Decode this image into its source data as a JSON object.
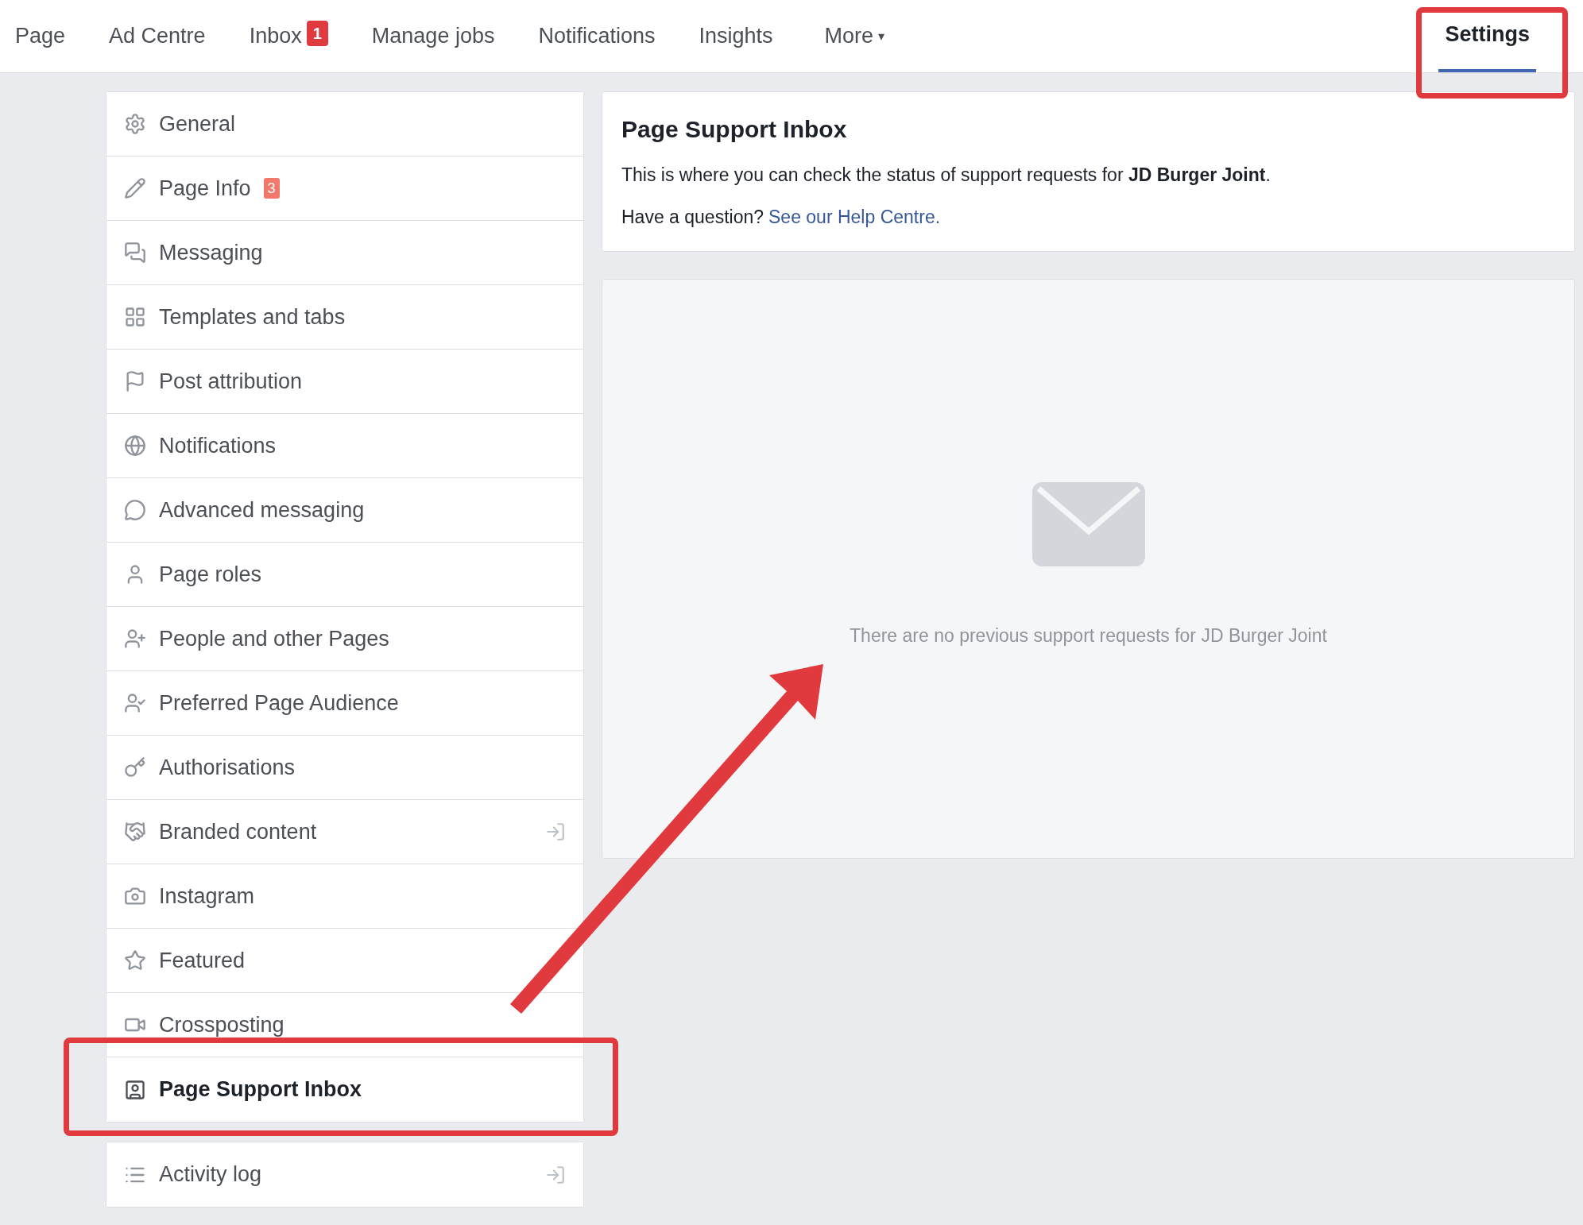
{
  "nav": {
    "tabs": [
      {
        "label": "Page",
        "selected": false
      },
      {
        "label": "Ad Centre",
        "selected": false
      },
      {
        "label": "Inbox",
        "badge": "1",
        "selected": false
      },
      {
        "label": "Manage jobs",
        "selected": false
      },
      {
        "label": "Notifications",
        "selected": false
      },
      {
        "label": "Insights",
        "selected": false
      },
      {
        "label": "More",
        "caret": "▾",
        "selected": false
      }
    ],
    "right_tab": {
      "label": "Settings",
      "selected": true
    }
  },
  "sidebar": {
    "items": [
      {
        "label": "General",
        "selected": false
      },
      {
        "label": "Page Info",
        "badge": "3",
        "selected": false
      },
      {
        "label": "Messaging",
        "selected": false
      },
      {
        "label": "Templates and tabs",
        "selected": false
      },
      {
        "label": "Post attribution",
        "selected": false
      },
      {
        "label": "Notifications",
        "selected": false
      },
      {
        "label": "Advanced messaging",
        "selected": false
      },
      {
        "label": "Page roles",
        "selected": false
      },
      {
        "label": "People and other Pages",
        "selected": false
      },
      {
        "label": "Preferred Page Audience",
        "selected": false
      },
      {
        "label": "Authorisations",
        "selected": false
      },
      {
        "label": "Branded content",
        "external": true,
        "selected": false
      },
      {
        "label": "Instagram",
        "selected": false
      },
      {
        "label": "Featured",
        "selected": false
      },
      {
        "label": "Crossposting",
        "selected": false
      },
      {
        "label": "Page Support Inbox",
        "selected": true
      }
    ],
    "footer_items": [
      {
        "label": "Activity log",
        "external": true,
        "selected": false
      }
    ]
  },
  "info_card": {
    "title": "Page Support Inbox",
    "text": "This is where you can check the status of support requests for **JD Burger Joint**.",
    "question": "Have a question?",
    "link": "See our Help Centre."
  },
  "empty_state": {
    "message": "There are no previous support requests for JD Burger Joint"
  }
}
